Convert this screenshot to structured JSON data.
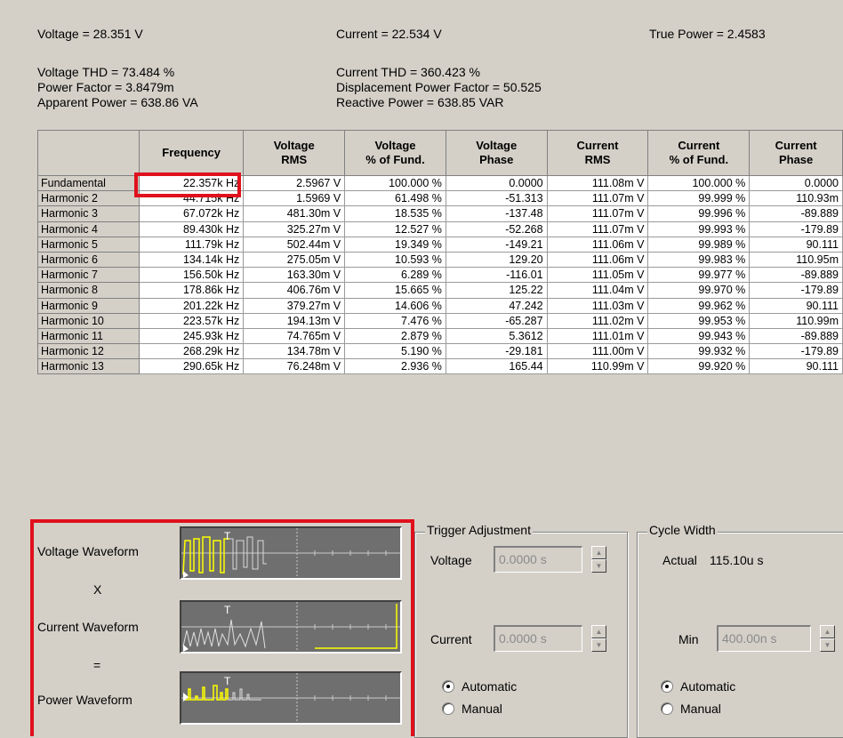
{
  "summary": {
    "voltage": "Voltage = 28.351 V",
    "current": "Current = 22.534 V",
    "true_power": "True Power = 2.4583",
    "voltage_thd": "Voltage THD = 73.484 %",
    "power_factor": "Power Factor = 3.8479m",
    "apparent_power": "Apparent Power = 638.86 VA",
    "current_thd": "Current THD = 360.423 %",
    "displacement_pf": "Displacement Power Factor = 50.525",
    "reactive_power": "Reactive Power = 638.85 VAR"
  },
  "table": {
    "headers": [
      "",
      "Frequency",
      "Voltage\nRMS",
      "Voltage\n% of Fund.",
      "Voltage\nPhase",
      "Current\nRMS",
      "Current\n% of Fund.",
      "Current\nPhase"
    ],
    "rows": [
      [
        "Fundamental",
        "22.357k Hz",
        "2.5967 V",
        "100.000 %",
        "0.0000",
        "111.08m V",
        "100.000 %",
        "0.0000"
      ],
      [
        "Harmonic 2",
        "44.715k Hz",
        "1.5969 V",
        "61.498 %",
        "-51.313",
        "111.07m V",
        "99.999 %",
        "110.93m"
      ],
      [
        "Harmonic 3",
        "67.072k Hz",
        "481.30m V",
        "18.535 %",
        "-137.48",
        "111.07m V",
        "99.996 %",
        "-89.889"
      ],
      [
        "Harmonic 4",
        "89.430k Hz",
        "325.27m V",
        "12.527 %",
        "-52.268",
        "111.07m V",
        "99.993 %",
        "-179.89"
      ],
      [
        "Harmonic 5",
        "111.79k Hz",
        "502.44m V",
        "19.349 %",
        "-149.21",
        "111.06m V",
        "99.989 %",
        "90.111"
      ],
      [
        "Harmonic 6",
        "134.14k Hz",
        "275.05m V",
        "10.593 %",
        "129.20",
        "111.06m V",
        "99.983 %",
        "110.95m"
      ],
      [
        "Harmonic 7",
        "156.50k Hz",
        "163.30m V",
        "6.289 %",
        "-116.01",
        "111.05m V",
        "99.977 %",
        "-89.889"
      ],
      [
        "Harmonic 8",
        "178.86k Hz",
        "406.76m V",
        "15.665 %",
        "125.22",
        "111.04m V",
        "99.970 %",
        "-179.89"
      ],
      [
        "Harmonic 9",
        "201.22k Hz",
        "379.27m V",
        "14.606 %",
        "47.242",
        "111.03m V",
        "99.962 %",
        "90.111"
      ],
      [
        "Harmonic 10",
        "223.57k Hz",
        "194.13m V",
        "7.476 %",
        "-65.287",
        "111.02m V",
        "99.953 %",
        "110.99m"
      ],
      [
        "Harmonic 11",
        "245.93k Hz",
        "74.765m V",
        "2.879 %",
        "5.3612",
        "111.01m V",
        "99.943 %",
        "-89.889"
      ],
      [
        "Harmonic 12",
        "268.29k Hz",
        "134.78m V",
        "5.190 %",
        "-29.181",
        "111.00m V",
        "99.932 %",
        "-179.89"
      ],
      [
        "Harmonic 13",
        "290.65k Hz",
        "76.248m V",
        "2.936 %",
        "165.44",
        "110.99m V",
        "99.920 %",
        "90.111"
      ]
    ]
  },
  "waveforms": {
    "voltage_label": "Voltage Waveform",
    "times": "X",
    "current_label": "Current Waveform",
    "equals": "=",
    "power_label": "Power Waveform",
    "trigger_marker": "T"
  },
  "trigger": {
    "title": "Trigger Adjustment",
    "voltage_label": "Voltage",
    "voltage_value": "0.0000 s",
    "current_label": "Current",
    "current_value": "0.0000 s",
    "automatic": "Automatic",
    "manual": "Manual",
    "selected": "Automatic"
  },
  "cycle": {
    "title": "Cycle Width",
    "actual_label": "Actual",
    "actual_value": "115.10u s",
    "min_label": "Min",
    "min_value": "400.00n s",
    "automatic": "Automatic",
    "manual": "Manual",
    "selected": "Automatic"
  },
  "colors": {
    "highlight": "#e0101c",
    "trace": "#ffff00",
    "scope_bg": "#6f6f6f",
    "panel_bg": "#d4d0c8"
  }
}
